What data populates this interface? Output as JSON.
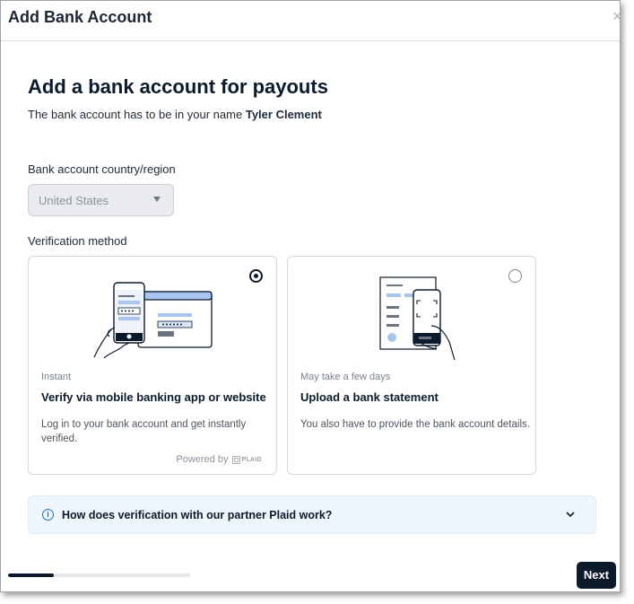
{
  "dialog": {
    "title": "Add Bank Account",
    "close_glyph": "×"
  },
  "main": {
    "heading": "Add a bank account for payouts",
    "subtitle_prefix": "The bank account has to be in your name",
    "account_holder": "Tyler Clement",
    "country_label": "Bank account country/region",
    "country_value": "United States",
    "method_label": "Verification method"
  },
  "methods": [
    {
      "tag": "Instant",
      "title": "Verify via mobile banking app or website",
      "description": "Log in to your bank account and get instantly verified.",
      "selected": true,
      "powered_by": "Powered by",
      "provider_logo_text": "PLAID",
      "icon": "phone-and-browser-illustration"
    },
    {
      "tag": "May take a few days",
      "title": "Upload a bank statement",
      "description": "You also have to provide the bank account details.",
      "selected": false,
      "icon": "phone-scanning-document-illustration"
    }
  ],
  "faq": {
    "question": "How does verification with our partner Plaid work?",
    "icon": "info-icon"
  },
  "footer": {
    "progress_fraction": 0.25,
    "next_label": "Next"
  },
  "colors": {
    "primary": "#0b1b2b",
    "info_accent": "#1a73c9",
    "faq_background": "#eef5fc",
    "illustration_blue": "#a9c4ee"
  }
}
